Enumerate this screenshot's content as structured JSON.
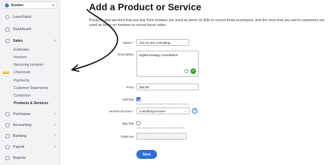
{
  "sidebar": {
    "company": "Syndeo",
    "items": [
      {
        "label": "Launchpad"
      },
      {
        "label": "Dashboard"
      },
      {
        "label": "Sales"
      },
      {
        "label": "Purchases"
      },
      {
        "label": "Accounting"
      },
      {
        "label": "Banking"
      },
      {
        "label": "Payroll"
      },
      {
        "label": "Reports"
      }
    ],
    "sales_sub": [
      {
        "label": "Estimates"
      },
      {
        "label": "Invoices"
      },
      {
        "label": "Recurring Invoices"
      },
      {
        "label": "Checkouts"
      },
      {
        "label": "Payments"
      },
      {
        "label": "Customer Statements"
      },
      {
        "label": "Customers"
      },
      {
        "label": "Products & Services"
      }
    ],
    "new_badge": "NEW"
  },
  "main": {
    "title": "Add a Product or Service",
    "description": "Products and services that you buy from vendors are used as items on Bills to record those purchases, and the ones that you sell to customers are used as items on Invoices to record those sales.",
    "form": {
      "name_label": "Name",
      "name_value": "one-on-one consulting",
      "description_label": "Description",
      "description_value": "Digital strategy consultation",
      "price_label": "Price",
      "price_value": "499.00",
      "sell_label": "Sell this",
      "sell_checked": true,
      "sell_hint": "Allow this product or service to be added to Invoices.",
      "income_label": "Income account",
      "income_value": "Consulting Income",
      "buy_label": "Buy this",
      "buy_checked": false,
      "buy_hint": "Allow this product or service to be added to Bills.",
      "sales_tax_label": "Sales tax",
      "save_label": "Save"
    }
  },
  "colors": {
    "accent": "#2d6fd8",
    "green": "#2ca01c",
    "required": "#d0342c",
    "new_badge": "#f5b400"
  }
}
